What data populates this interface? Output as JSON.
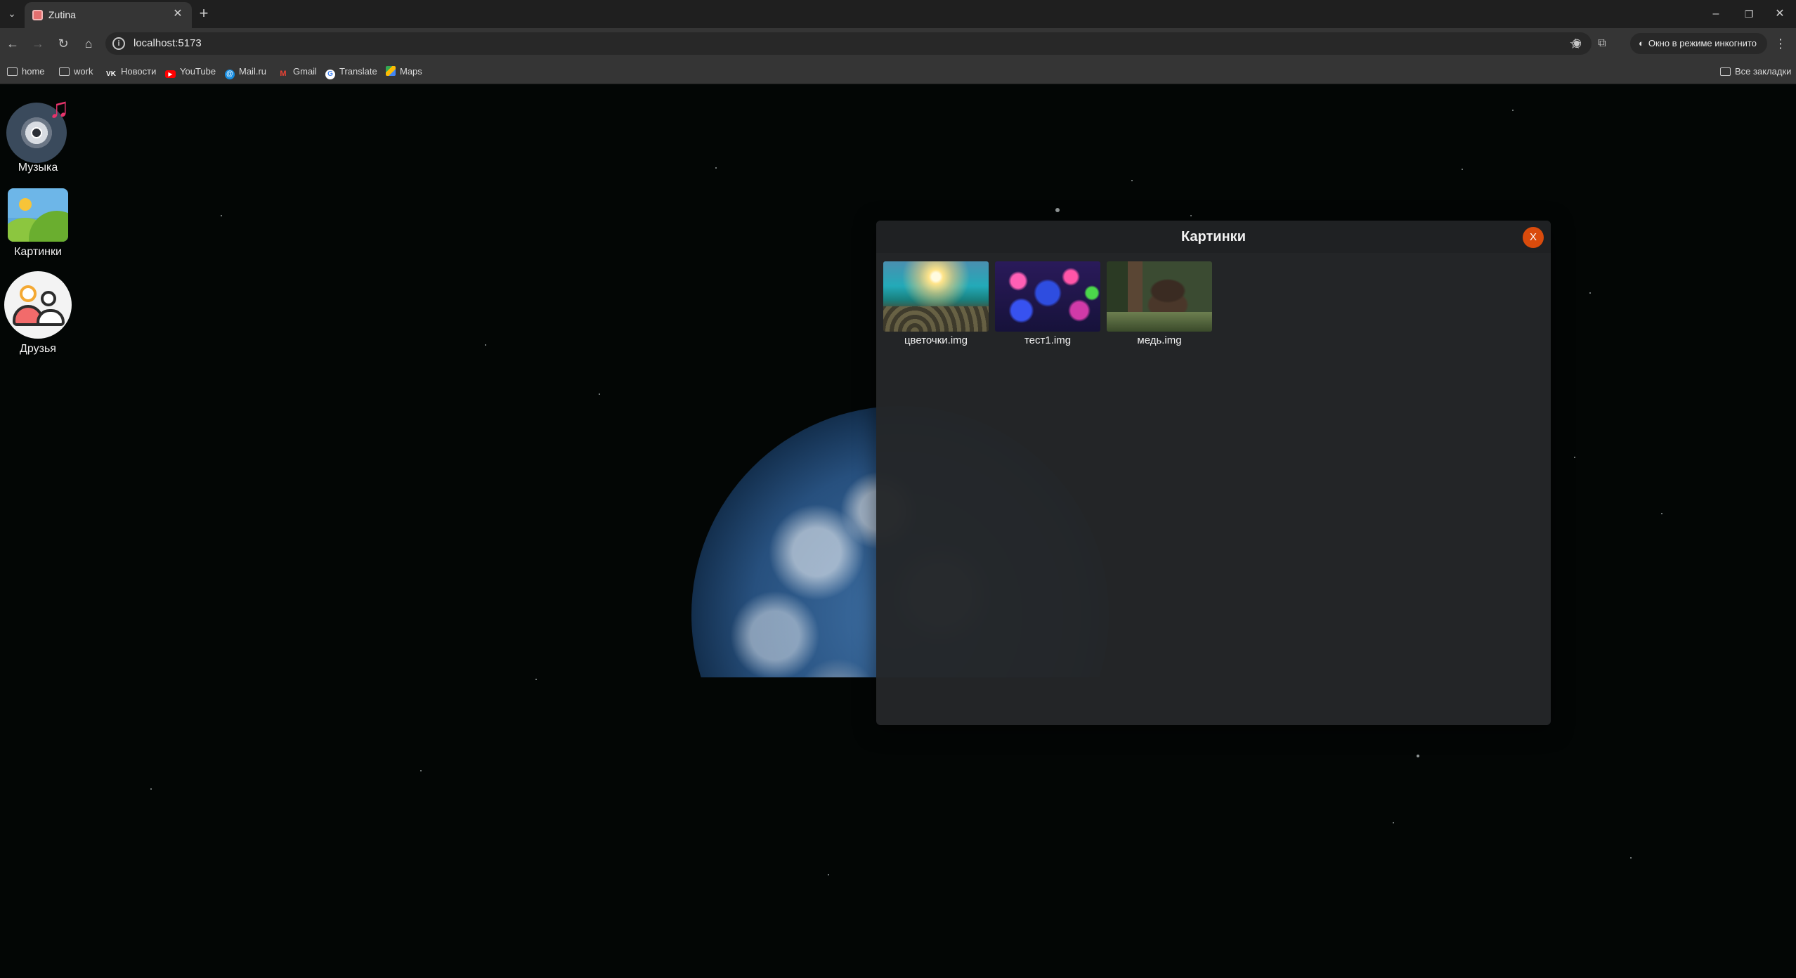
{
  "browser": {
    "tab": {
      "title": "Zutina",
      "favicon": "zutina-favicon"
    },
    "address": {
      "url": "localhost:5173"
    },
    "incognito_label": "Окно в режиме инкогнито",
    "bookmarks": [
      {
        "label": "home",
        "icon": "folder-icon"
      },
      {
        "label": "work",
        "icon": "folder-icon"
      },
      {
        "label": "Новости",
        "icon": "vk-icon"
      },
      {
        "label": "YouTube",
        "icon": "youtube-icon"
      },
      {
        "label": "Mail.ru",
        "icon": "mailru-icon"
      },
      {
        "label": "Gmail",
        "icon": "gmail-icon"
      },
      {
        "label": "Translate",
        "icon": "google-icon"
      },
      {
        "label": "Maps",
        "icon": "maps-icon"
      }
    ],
    "all_bookmarks_label": "Все закладки"
  },
  "desktop": {
    "icons": [
      {
        "label": "Музыка",
        "icon": "music-icon"
      },
      {
        "label": "Картинки",
        "icon": "pictures-icon"
      },
      {
        "label": "Друзья",
        "icon": "friends-icon"
      }
    ]
  },
  "window": {
    "title": "Картинки",
    "close_label": "X",
    "accent": "#d94b0c",
    "files": [
      {
        "name": "цветочки.img",
        "thumbnail": "underwater-reef"
      },
      {
        "name": "тест1.img",
        "thumbnail": "colorful-flowers"
      },
      {
        "name": "медь.img",
        "thumbnail": "bear-forest"
      }
    ]
  }
}
